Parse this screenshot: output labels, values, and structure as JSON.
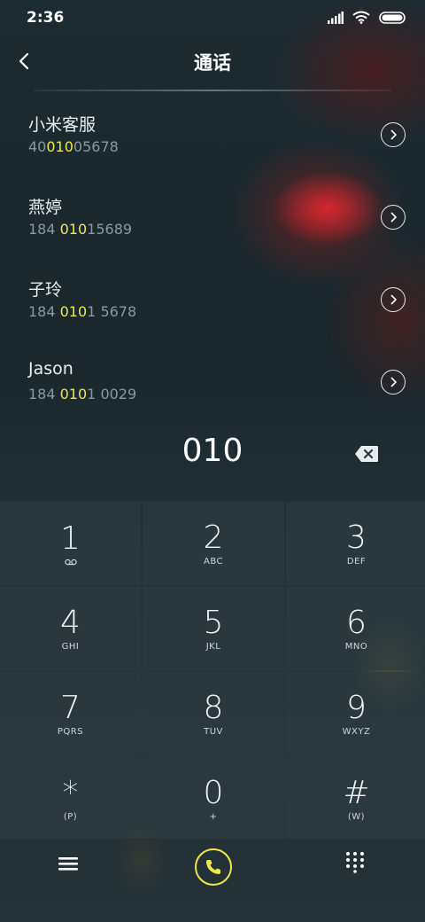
{
  "status": {
    "time": "2:36"
  },
  "header": {
    "title": "通话"
  },
  "results": [
    {
      "name": "小米客服",
      "num_pre": "40",
      "num_match": "010",
      "num_post": "05678"
    },
    {
      "name": "燕婷",
      "num_pre": "184 ",
      "num_match": "010",
      "num_post": "15689"
    },
    {
      "name": "子玲",
      "num_pre": "184 ",
      "num_match": "010",
      "num_post": "1 5678"
    },
    {
      "name": "Jason",
      "num_pre": "184 ",
      "num_match": "010",
      "num_post": "1 0029"
    }
  ],
  "dialer": {
    "entered": "010"
  },
  "keys": [
    {
      "digit": "1",
      "letters": "voicemail-icon"
    },
    {
      "digit": "2",
      "letters": "ABC"
    },
    {
      "digit": "3",
      "letters": "DEF"
    },
    {
      "digit": "4",
      "letters": "GHI"
    },
    {
      "digit": "5",
      "letters": "JKL"
    },
    {
      "digit": "6",
      "letters": "MNO"
    },
    {
      "digit": "7",
      "letters": "PQRS"
    },
    {
      "digit": "8",
      "letters": "TUV"
    },
    {
      "digit": "9",
      "letters": "WXYZ"
    },
    {
      "digit": "*",
      "letters": "(P)"
    },
    {
      "digit": "0",
      "letters": "+"
    },
    {
      "digit": "#",
      "letters": "(W)"
    }
  ],
  "colors": {
    "accent": "#f0e84a",
    "muted": "#8c989d"
  }
}
